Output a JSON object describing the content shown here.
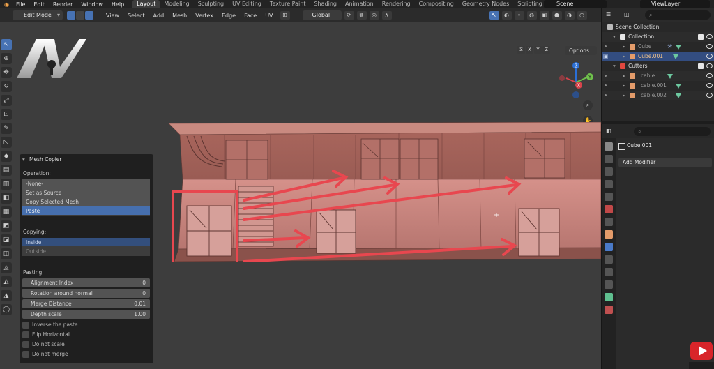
{
  "topbar": {
    "menus": [
      "File",
      "Edit",
      "Render",
      "Window",
      "Help"
    ],
    "workspaces": [
      "Layout",
      "Modeling",
      "Sculpting",
      "UV Editing",
      "Texture Paint",
      "Shading",
      "Animation",
      "Rendering",
      "Compositing",
      "Geometry Nodes",
      "Scripting"
    ],
    "add_tab": "+",
    "scene": "Scene",
    "view_layer": "ViewLayer"
  },
  "viewport_header": {
    "mode": "Edit Mode",
    "menus": [
      "View",
      "Select",
      "Add",
      "Mesh",
      "Vertex",
      "Edge",
      "Face",
      "UV"
    ],
    "transform_orientation": "Global",
    "axes": [
      "X",
      "Y",
      "Z"
    ],
    "options_label": "Options"
  },
  "gizmo": {
    "z": "Z",
    "y": "Y",
    "x": "X"
  },
  "panel": {
    "title": "Mesh Copier",
    "operation_label": "Operation:",
    "operation_options": [
      "-None-",
      "Set as Source",
      "Copy Selected Mesh",
      "Paste"
    ],
    "operation_selected": "Paste",
    "copying_label": "Copying:",
    "copying_options": [
      "Inside",
      "Outside"
    ],
    "pasting_label": "Pasting:",
    "fields": [
      {
        "label": "Alignment Index",
        "value": "0"
      },
      {
        "label": "Rotation around normal",
        "value": "0"
      },
      {
        "label": "Merge Distance",
        "value": "0.01"
      },
      {
        "label": "Depth scale",
        "value": "1.00"
      }
    ],
    "checkboxes": [
      "Inverse the paste",
      "Flip Horizontal",
      "Do not scale",
      "Do not merge"
    ]
  },
  "outliner": {
    "rows": [
      {
        "name": "Scene Collection"
      },
      {
        "name": "Collection"
      },
      {
        "name": "Cube"
      },
      {
        "name": "Cube.001"
      },
      {
        "name": "Cutters"
      },
      {
        "name": "cable"
      },
      {
        "name": "cable.001"
      },
      {
        "name": "cable.002"
      }
    ]
  },
  "properties": {
    "object_name": "Cube.001",
    "add_modifier": "Add Modifier"
  },
  "colors": {
    "accent": "#4772b3",
    "arrow": "#e8474f",
    "mesh_color": "#c0746a"
  }
}
